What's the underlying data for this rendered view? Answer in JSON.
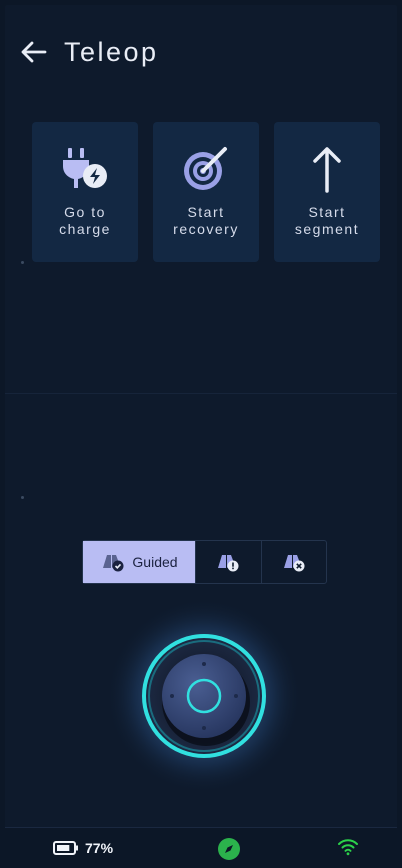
{
  "header": {
    "title": "Teleop"
  },
  "actions": [
    {
      "label": "Go to\ncharge",
      "icon": "plug-charge-icon"
    },
    {
      "label": "Start\nrecovery",
      "icon": "radar-target-icon"
    },
    {
      "label": "Start\nsegment",
      "icon": "arrow-up-icon"
    }
  ],
  "modes": {
    "items": [
      {
        "label": "Guided",
        "icon": "guided-check-icon",
        "active": true
      },
      {
        "label": "",
        "icon": "guided-warning-icon",
        "active": false
      },
      {
        "label": "",
        "icon": "guided-cancel-icon",
        "active": false
      }
    ]
  },
  "status": {
    "battery_percent": "77%",
    "battery_level": 0.77,
    "compass_icon": "compass-icon",
    "wifi_icon": "wifi-icon"
  },
  "colors": {
    "background": "#0e1a2c",
    "card": "#132843",
    "accent": "#31e0e0",
    "mode_active": "#b9bdf3",
    "compass": "#2bb24c",
    "wifi": "#2bd14a"
  }
}
